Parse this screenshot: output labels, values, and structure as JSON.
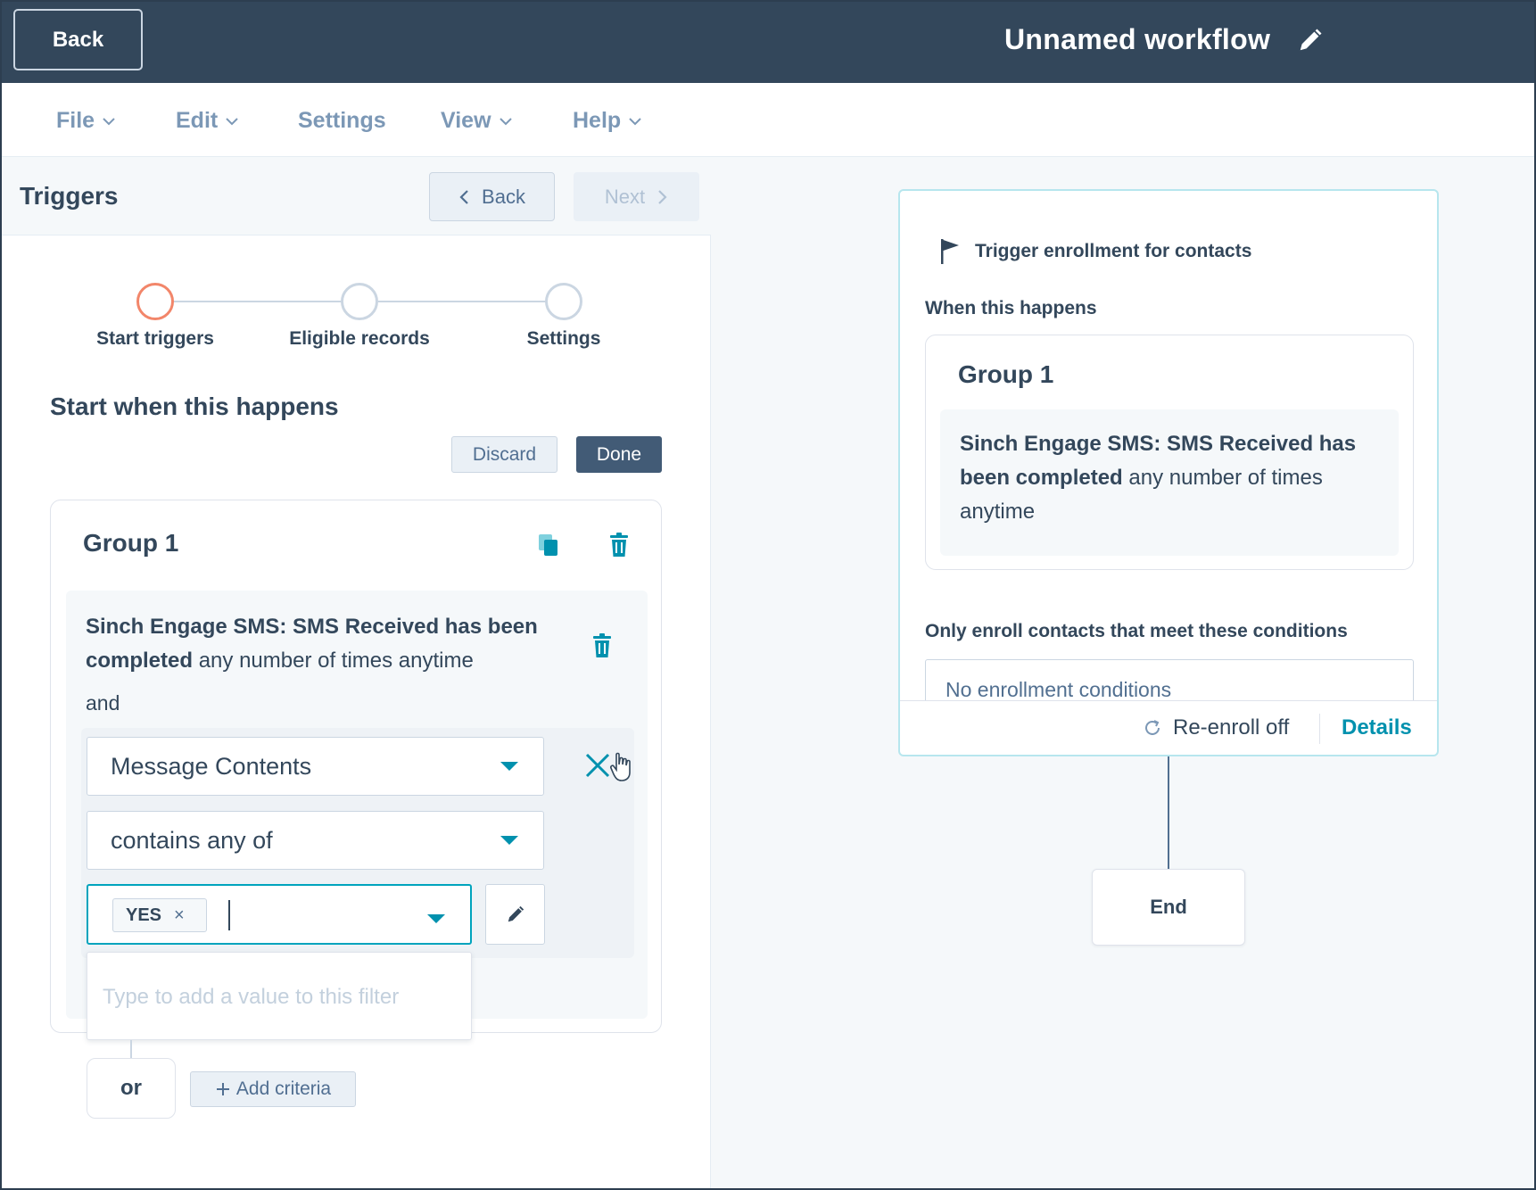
{
  "topbar": {
    "back_label": "Back",
    "workflow_title": "Unnamed workflow",
    "edit_icon": "pencil-icon"
  },
  "menu": {
    "items": [
      {
        "label": "File"
      },
      {
        "label": "Edit"
      },
      {
        "label": "Settings"
      },
      {
        "label": "View"
      },
      {
        "label": "Help"
      }
    ]
  },
  "left": {
    "title": "Triggers",
    "back_label": "Back",
    "next_label": "Next",
    "steps": [
      {
        "label": "Start triggers"
      },
      {
        "label": "Eligible records"
      },
      {
        "label": "Settings"
      }
    ],
    "start_when": "Start when this happens",
    "discard_label": "Discard",
    "done_label": "Done",
    "group": {
      "title": "Group 1",
      "criteria_bold": "Sinch Engage SMS: SMS Received has been completed",
      "criteria_rest": " any number of times anytime",
      "and_label": "and",
      "property_value": "Message Contents",
      "operator_value": "contains any of",
      "tag_value": "YES",
      "tag_remove": "×",
      "filter_placeholder": "Type to add a value to this filter"
    },
    "or_label": "or",
    "add_criteria_label": "Add criteria"
  },
  "right": {
    "trigger_title": "Trigger enrollment for contacts",
    "when_label": "When this happens",
    "group_title": "Group 1",
    "criteria_bold": "Sinch Engage SMS: SMS Received has been completed",
    "criteria_rest": " any number of times anytime",
    "only_label": "Only enroll contacts that meet these conditions",
    "no_conditions": "No enrollment conditions",
    "reenroll_label": "Re-enroll off",
    "details_label": "Details",
    "end_label": "End"
  },
  "colors": {
    "topbar": "#33475b",
    "accent": "#0091ae",
    "active_step": "#f2866a",
    "done_button": "#425b76"
  }
}
